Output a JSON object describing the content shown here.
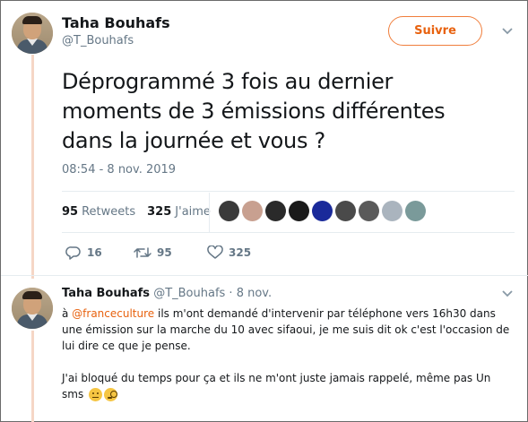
{
  "main_tweet": {
    "author_name": "Taha Bouhafs",
    "author_handle": "@T_Bouhafs",
    "follow_label": "Suivre",
    "text_lines": [
      "Déprogrammé 3 fois au dernier",
      "moments de 3 émissions différentes",
      "dans la journée et vous ?"
    ],
    "timestamp": "08:54 - 8 nov. 2019",
    "retweets_count": "95",
    "retweets_label": "Retweets",
    "likes_count": "325",
    "likes_label": "J'aime",
    "likers": [
      "#3a3a3a",
      "#c8a090",
      "#2a2a2a",
      "#1a1a1a",
      "#1a2a9a",
      "#4a4a4a",
      "#5a5a5a",
      "#aab4be",
      "#7a9a9a"
    ],
    "actions": {
      "reply_count": "16",
      "retweet_count": "95",
      "like_count": "325"
    }
  },
  "reply_tweet": {
    "author_name": "Taha Bouhafs",
    "author_handle": "@T_Bouhafs",
    "date": "8 nov.",
    "separator": " · ",
    "mention_prefix": "à ",
    "mention": "@franceculture",
    "para1_rest": " ils m'ont demandé d'intervenir par téléphone vers 16h30 dans une émission sur la marche du 10 avec sifaoui, je me suis dit ok c'est l'occasion de lui dire ce que je pense.",
    "para2": "J'ai bloqué du temps pour ça et ils ne m'ont juste jamais rappelé, même pas Un sms",
    "emojis": [
      "neutral-face",
      "face-with-monocle"
    ]
  },
  "colors": {
    "accent": "#e8620f",
    "thread_line": "#f5d6c6",
    "muted": "#657786"
  }
}
